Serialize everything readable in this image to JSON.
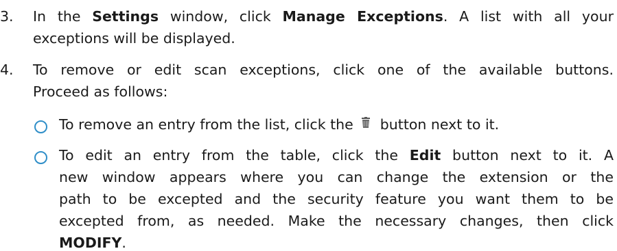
{
  "doc": {
    "step3": {
      "number": "3.",
      "line1_a": "In the ",
      "line1_b": "Settings",
      "line1_c": " window, click ",
      "line1_d": "Manage Exceptions",
      "line1_e": ". A list with all your",
      "line2": "exceptions will be displayed."
    },
    "step4": {
      "number": "4.",
      "line1": "To remove or edit scan exceptions, click one of the available buttons.",
      "line2": "Proceed as follows:"
    },
    "bullet1": {
      "text_a": "To remove an entry from the list, click the ",
      "icon": "trash-icon",
      "text_b": " button next to it."
    },
    "bullet2": {
      "line1_a": "To edit an entry from the table, click the ",
      "line1_b": "Edit",
      "line1_c": " button next to it. A",
      "line2": "new window appears where you can change the extension or the",
      "line3": "path to be excepted and the security feature you want them to be",
      "line4": "excepted from, as needed. Make the necessary changes, then click",
      "line5": "MODIFY",
      "line5_end": "."
    },
    "colors": {
      "text": "#1a1a1a",
      "bullet": "#2f8ec8"
    }
  }
}
